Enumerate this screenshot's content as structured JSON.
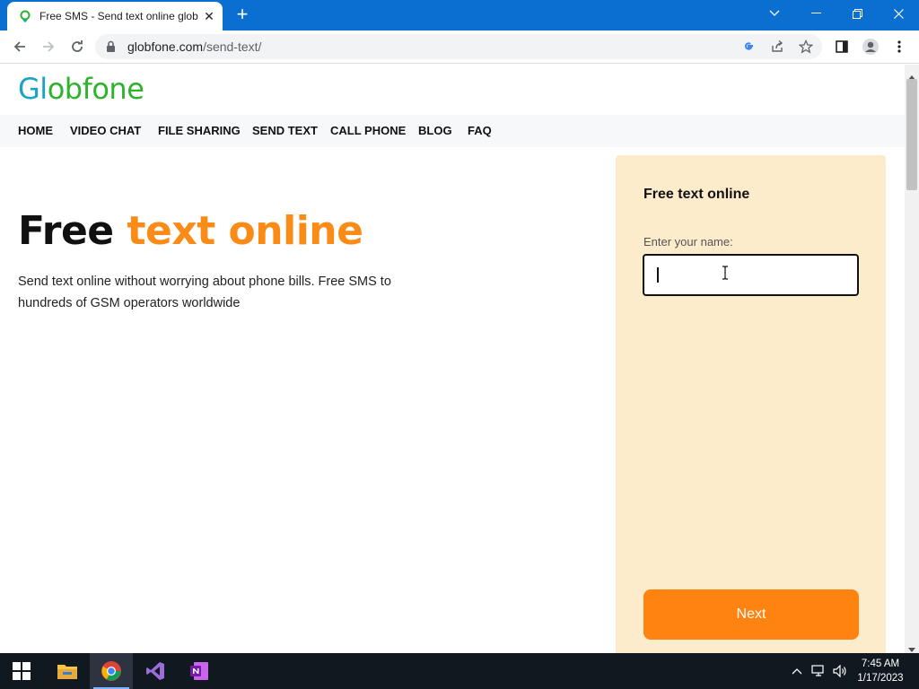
{
  "browser": {
    "tab_title": "Free SMS - Send text online glob",
    "url_host": "globfone.com",
    "url_path": "/send-text/"
  },
  "site": {
    "logo_part1": "Gl",
    "logo_part2": "o",
    "logo_part3": "bfone",
    "nav": [
      "HOME",
      "VIDEO CHAT",
      "FILE SHARING",
      "SEND TEXT",
      "CALL PHONE",
      "BLOG",
      "FAQ"
    ]
  },
  "hero": {
    "title_word1": "Free",
    "title_word2": "text online",
    "description": "Send text online without worrying about phone bills. Free SMS to hundreds of GSM operators worldwide"
  },
  "form": {
    "title": "Free text online",
    "name_label": "Enter your name:",
    "name_value": "",
    "next_label": "Next"
  },
  "taskbar": {
    "time": "7:45 AM",
    "date": "1/17/2023"
  },
  "colors": {
    "accent": "#fe8311",
    "brand_blue": "#1aa3c4",
    "brand_green": "#2db42a",
    "card_bg": "#fdeccc",
    "titlebar": "#0b6fd1"
  }
}
